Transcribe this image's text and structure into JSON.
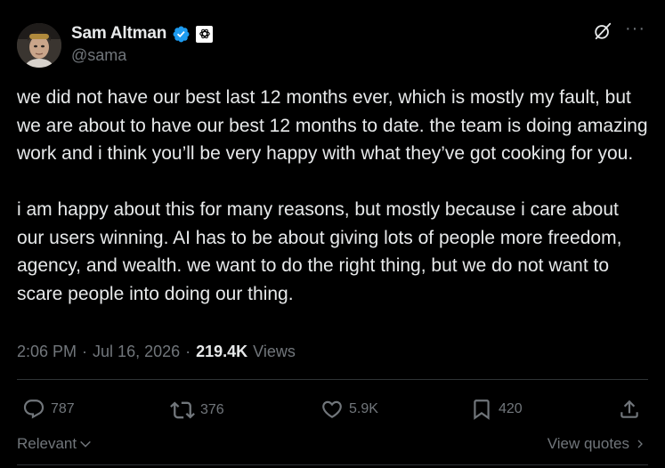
{
  "author": {
    "display_name": "Sam Altman",
    "handle": "@sama",
    "verified_icon": "verified-badge-icon",
    "affiliation_icon": "openai-logo-icon",
    "colors": {
      "verified": "#1d9bf0"
    }
  },
  "top_icons": {
    "grok": "grok-icon",
    "more": "···"
  },
  "tweet": {
    "paragraphs": [
      "we did not have our best last 12 months ever, which is mostly my fault, but we are about to have our best 12 months to date. the team is doing amazing work and i think you’ll be very happy with what they’ve got cooking for you.",
      "i am happy about this for many reasons, but mostly because i care about our users winning. AI has to be about giving lots of people more freedom, agency, and wealth. we want to do the right thing, but we do not want to scare people into doing our thing."
    ]
  },
  "meta": {
    "time": "2:06 PM",
    "separator": "·",
    "date": "Jul 16, 2026",
    "views_count": "219.4K",
    "views_label": "Views"
  },
  "actions": {
    "replies": "787",
    "reposts": "376",
    "likes": "5.9K",
    "bookmarks": "420"
  },
  "footer": {
    "sort_label": "Relevant",
    "quotes_label": "View quotes"
  },
  "colors": {
    "background": "#000000",
    "text": "#e7e9ea",
    "muted": "#71767b",
    "divider": "#2f3336"
  }
}
